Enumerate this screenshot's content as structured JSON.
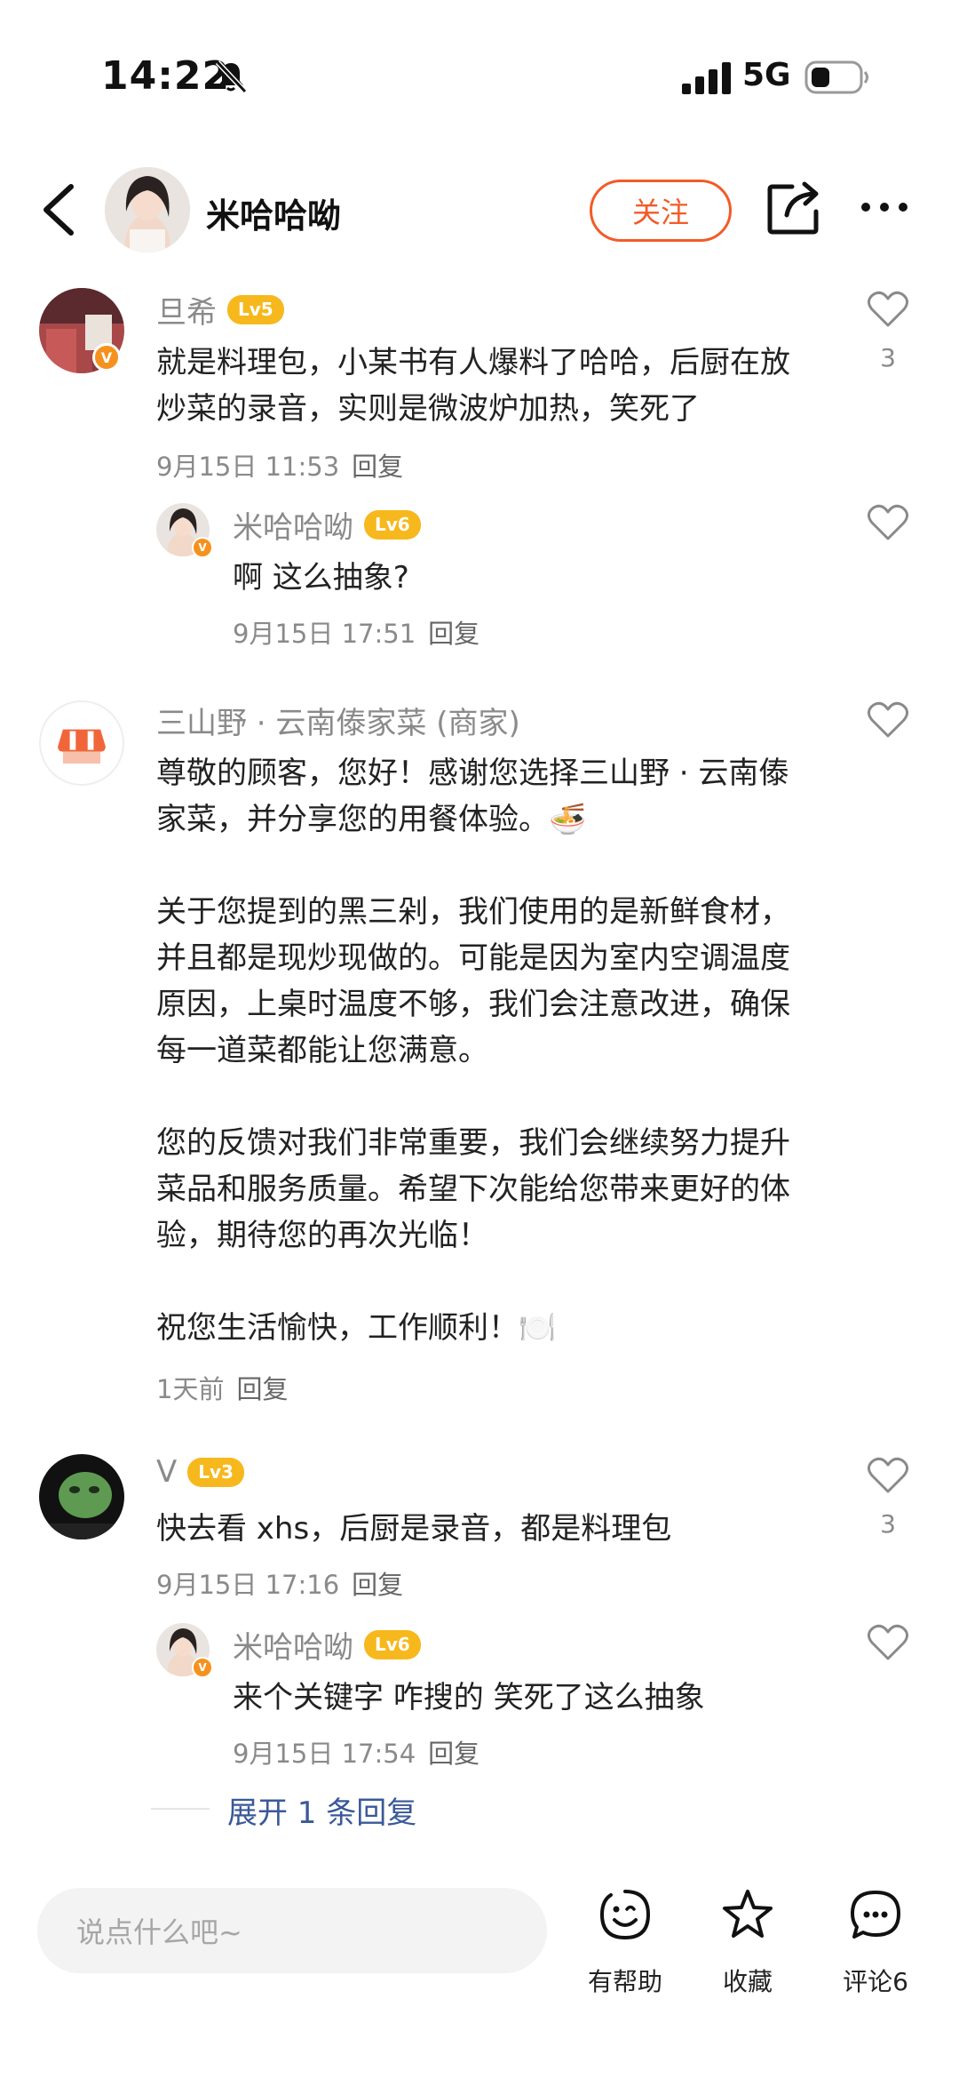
{
  "status_bar": {
    "time": "14:22",
    "network": "5G"
  },
  "header": {
    "author_name": "米哈哈呦",
    "follow_label": "关注"
  },
  "comments": [
    {
      "username": "旦希",
      "level": "Lv5",
      "badge": "V",
      "text": "就是料理包，小某书有人爆料了哈哈，后厨在放\n炒菜的录音，实则是微波炉加热，笑死了",
      "date": "9月15日  11:53",
      "reply_label": "回复",
      "likes": "3",
      "replies": [
        {
          "username": "米哈哈呦",
          "level": "Lv6",
          "badge": "V",
          "text": "啊 这么抽象?",
          "date": "9月15日  17:51",
          "reply_label": "回复"
        }
      ]
    },
    {
      "username": "三山野 · 云南傣家菜 (商家)",
      "text": "尊敬的顾客，您好！感谢您选择三山野 · 云南傣\n家菜，并分享您的用餐体验。🍜\n\n关于您提到的黑三剁，我们使用的是新鲜食材，\n并且都是现炒现做的。可能是因为室内空调温度\n原因，上桌时温度不够，我们会注意改进，确保\n每一道菜都能让您满意。\n\n您的反馈对我们非常重要，我们会继续努力提升\n菜品和服务质量。希望下次能给您带来更好的体\n验，期待您的再次光临！\n\n祝您生活愉快，工作顺利！🍽️",
      "date": "1天前",
      "reply_label": "回复"
    },
    {
      "username": "V",
      "level": "Lv3",
      "text": "快去看 xhs，后厨是录音，都是料理包",
      "date": "9月15日  17:16",
      "reply_label": "回复",
      "likes": "3",
      "replies": [
        {
          "username": "米哈哈呦",
          "level": "Lv6",
          "badge": "V",
          "text": "来个关键字 咋搜的 笑死了这么抽象",
          "date": "9月15日  17:54",
          "reply_label": "回复"
        }
      ]
    }
  ],
  "expand_replies": "展开 1 条回复",
  "bottom_bar": {
    "input_placeholder": "说点什么吧~",
    "helpful_label": "有帮助",
    "favorite_label": "收藏",
    "comments_label": "评论6"
  },
  "colors": {
    "accent": "#f25b28",
    "level_badge": "#f6b81d",
    "v_badge": "#f5921e",
    "link": "#3a5998"
  }
}
